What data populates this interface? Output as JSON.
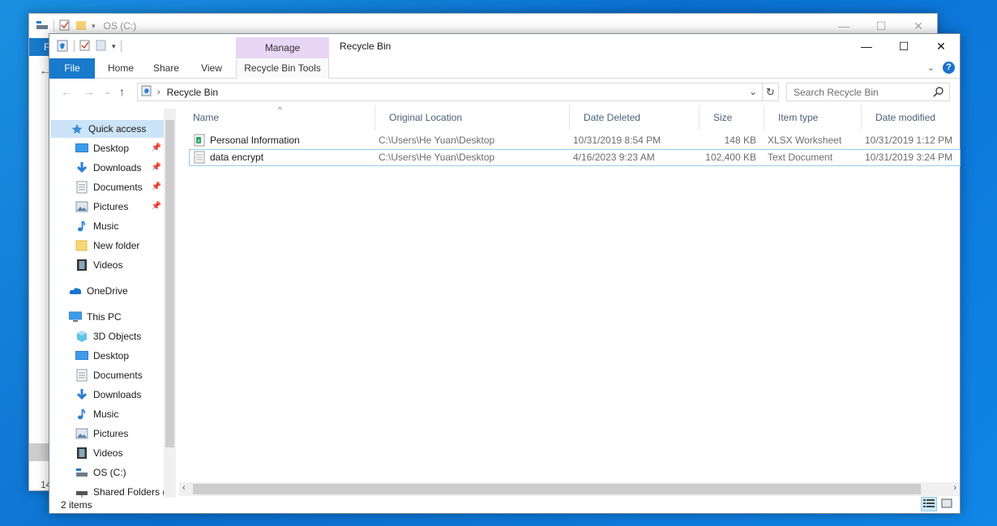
{
  "back_window": {
    "title": "OS (C:)",
    "file_tab_label": "F",
    "partial_text": "14"
  },
  "window": {
    "title": "Recycle Bin",
    "manage_tab": "Manage",
    "contextual_tab": "Recycle Bin Tools",
    "tabs": [
      "File",
      "Home",
      "Share",
      "View"
    ]
  },
  "address": {
    "location": "Recycle Bin",
    "search_placeholder": "Search Recycle Bin"
  },
  "sidebar": {
    "quick_access": "Quick access",
    "quick_items": [
      {
        "label": "Desktop",
        "icon": "desktop-icon",
        "pinned": true
      },
      {
        "label": "Downloads",
        "icon": "downloads-icon",
        "pinned": true
      },
      {
        "label": "Documents",
        "icon": "documents-icon",
        "pinned": true
      },
      {
        "label": "Pictures",
        "icon": "pictures-icon",
        "pinned": true
      },
      {
        "label": "Music",
        "icon": "music-icon",
        "pinned": false
      },
      {
        "label": "New folder",
        "icon": "folder-icon",
        "pinned": false
      },
      {
        "label": "Videos",
        "icon": "videos-icon",
        "pinned": false
      }
    ],
    "onedrive": "OneDrive",
    "this_pc": "This PC",
    "pc_items": [
      {
        "label": "3D Objects",
        "icon": "3d-objects-icon"
      },
      {
        "label": "Desktop",
        "icon": "desktop-icon"
      },
      {
        "label": "Documents",
        "icon": "documents-icon"
      },
      {
        "label": "Downloads",
        "icon": "downloads-icon"
      },
      {
        "label": "Music",
        "icon": "music-icon"
      },
      {
        "label": "Pictures",
        "icon": "pictures-icon"
      },
      {
        "label": "Videos",
        "icon": "videos-icon"
      },
      {
        "label": "OS (C:)",
        "icon": "drive-icon"
      },
      {
        "label": "Shared Folders (",
        "icon": "network-drive-icon"
      }
    ]
  },
  "columns": [
    "Name",
    "Original Location",
    "Date Deleted",
    "Size",
    "Item type",
    "Date modified"
  ],
  "files": [
    {
      "name": "Personal Information",
      "location": "C:\\Users\\He Yuan\\Desktop",
      "date_deleted": "10/31/2019 8:54 PM",
      "size": "148 KB",
      "type": "XLSX Worksheet",
      "date_modified": "10/31/2019 1:12 PM",
      "icon": "xlsx-file-icon"
    },
    {
      "name": "data encrypt",
      "location": "C:\\Users\\He Yuan\\Desktop",
      "date_deleted": "4/16/2023 9:23 AM",
      "size": "102,400 KB",
      "type": "Text Document",
      "date_modified": "10/31/2019 3:24 PM",
      "icon": "text-file-icon"
    }
  ],
  "status": {
    "item_count": "2 items"
  },
  "colors": {
    "accent": "#1979ca",
    "manage_tab": "#e9d5f5",
    "selection": "#cce4f7"
  }
}
